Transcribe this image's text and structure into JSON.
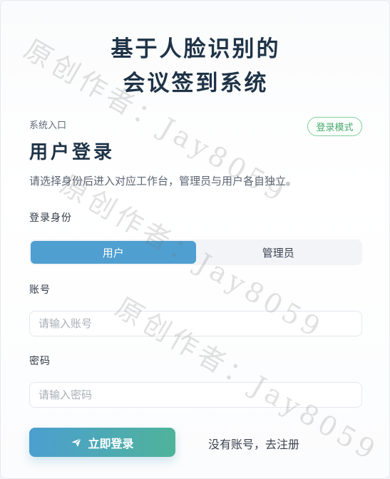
{
  "header": {
    "title_line1": "基于人脸识别的",
    "title_line2": "会议签到系统"
  },
  "login": {
    "entry_label": "系统入口",
    "mode_badge": "登录模式",
    "heading": "用户登录",
    "subtitle": "请选择身份后进入对应工作台，管理员与用户各自独立。"
  },
  "form": {
    "role_label": "登录身份",
    "roles": [
      {
        "label": "用户",
        "active": true
      },
      {
        "label": "管理员",
        "active": false
      }
    ],
    "account_label": "账号",
    "account_placeholder": "请输入账号",
    "password_label": "密码",
    "password_placeholder": "请输入密码",
    "submit_label": "立即登录",
    "register_link": "没有账号，去注册"
  },
  "watermark": "原创作者：Jay8059",
  "colors": {
    "primary": "#4f9fd1",
    "accent_green": "#4fb39a",
    "badge_green": "#49a870",
    "title": "#1f3347"
  },
  "icons": {
    "submit": "paper-plane-icon"
  }
}
